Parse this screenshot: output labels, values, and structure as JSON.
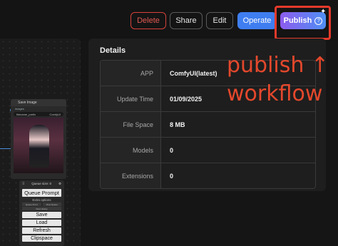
{
  "toolbar": {
    "delete_label": "Delete",
    "share_label": "Share",
    "edit_label": "Edit",
    "operate_label": "Operate",
    "publish_label": "Publish",
    "help_icon": "?"
  },
  "details": {
    "title": "Details",
    "rows": [
      {
        "label": "APP",
        "value": "ComfyUI(latest)"
      },
      {
        "label": "Update Time",
        "value": "01/09/2025"
      },
      {
        "label": "File Space",
        "value": "8 MB"
      },
      {
        "label": "Models",
        "value": "0"
      },
      {
        "label": "Extensions",
        "value": "0"
      }
    ]
  },
  "annotation": {
    "line1": "publish ↑",
    "line2": "workflow",
    "color": "#e5482c"
  },
  "workflow": {
    "save_node": {
      "title": "Save Image",
      "output": "images",
      "field_name": "filename_prefix",
      "field_value": "ComfyUI"
    },
    "queue_node": {
      "title": "Queue size: 0",
      "queue_prompt": "Queue Prompt",
      "extra_options": "Extra options",
      "queue_front": "Queue Front",
      "view_queue": "View Queue",
      "view_history": "View History",
      "save": "Save",
      "load": "Load",
      "refresh": "Refresh",
      "clipspace": "Clipspace"
    }
  },
  "colors": {
    "delete": "#d5423b",
    "operate": "#3f7ef0",
    "publish_gradient_start": "#8d5cf0",
    "publish_gradient_end": "#4e8ff2",
    "highlight": "#e53a2b"
  }
}
